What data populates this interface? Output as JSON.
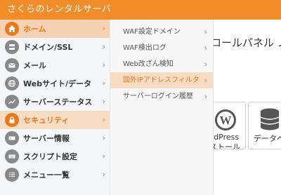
{
  "header": {
    "title": "さくらのレンタルサーバ"
  },
  "page": {
    "title": "ロールパネル ノ"
  },
  "tiles": [
    {
      "icon": "wordpress-icon",
      "line1": "rdPress",
      "line2": "ストール"
    },
    {
      "icon": "database-icon",
      "line1": "データベ",
      "line2": ""
    }
  ],
  "sidebar": {
    "items": [
      {
        "label": "ホーム",
        "icon": "home-icon",
        "active": true
      },
      {
        "label": "ドメイン/SSL",
        "icon": "server-icon"
      },
      {
        "label": "メール",
        "icon": "mail-icon"
      },
      {
        "label": "Webサイト/データ",
        "icon": "globe-icon"
      },
      {
        "label": "サーバーステータス",
        "icon": "chart-icon"
      },
      {
        "label": "セキュリティ",
        "icon": "lock-icon",
        "active": true
      },
      {
        "label": "サーバー情報",
        "icon": "server-info-icon"
      },
      {
        "label": "スクリプト設定",
        "icon": "keyboard-icon"
      },
      {
        "label": "メニュー一覧",
        "icon": "list-icon"
      }
    ]
  },
  "submenu": {
    "items": [
      {
        "label": "WAF設定ドメイン"
      },
      {
        "label": "WAF検出ログ"
      },
      {
        "label": "Web改ざん検知"
      },
      {
        "label": "国外IPアドレスフィルタ",
        "active": true
      },
      {
        "label": "サーバーログイン履歴"
      }
    ]
  },
  "chevron": "›"
}
